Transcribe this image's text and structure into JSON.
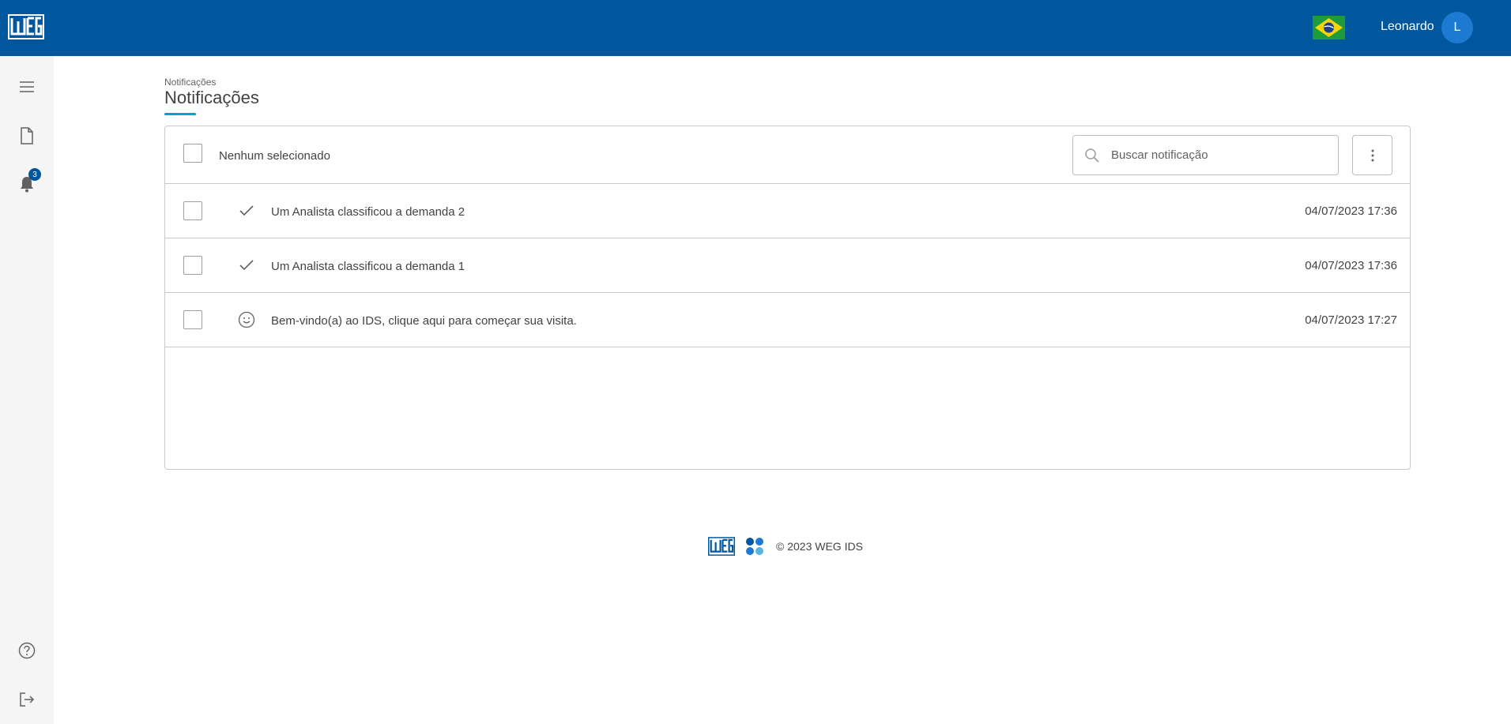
{
  "brand": {
    "logo_text": "WEG",
    "primary_color": "#00579d",
    "accent_color": "#00a3c9",
    "flag_icon": "brazil-flag-icon"
  },
  "header": {
    "user_name": "Leonardo",
    "avatar_initial": "L"
  },
  "sidebar": {
    "items": [
      {
        "name": "menu",
        "icon": "menu-icon"
      },
      {
        "name": "documents",
        "icon": "document-icon"
      },
      {
        "name": "notifications",
        "icon": "bell-icon",
        "badge": "3"
      },
      {
        "name": "help",
        "icon": "help-icon"
      },
      {
        "name": "logout",
        "icon": "logout-icon"
      }
    ]
  },
  "page": {
    "breadcrumb": "Notificações",
    "title": "Notificações"
  },
  "toolbar": {
    "selection_label": "Nenhum selecionado",
    "search_placeholder": "Buscar notificação"
  },
  "notifications": [
    {
      "icon": "check-icon",
      "text": "Um Analista classificou a demanda 2",
      "date": "04/07/2023 17:36"
    },
    {
      "icon": "check-icon",
      "text": "Um Analista classificou a demanda 1",
      "date": "04/07/2023 17:36"
    },
    {
      "icon": "smiley-icon",
      "text": "Bem-vindo(a) ao IDS, clique aqui para começar sua visita.",
      "date": "04/07/2023 17:27"
    }
  ],
  "footer": {
    "copyright": "© 2023 WEG IDS"
  }
}
